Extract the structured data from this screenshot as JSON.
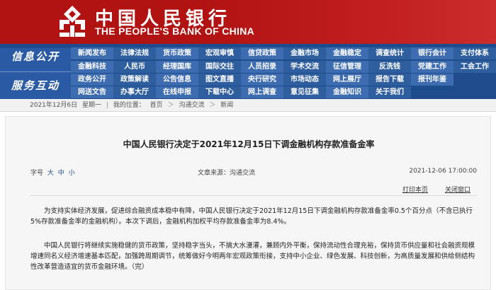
{
  "header": {
    "bank_name_cn": "中国人民银行",
    "bank_name_en": "THE PEOPLE'S BANK OF CHINA",
    "logo_icon": "pboc-emblem-icon",
    "colors": {
      "header_bg": "#b11212",
      "nav_bg": "#1e4b8c"
    }
  },
  "nav": {
    "info_label": "信息公开",
    "service_label": "服务互动",
    "row1": [
      "新闻发布",
      "法律法规",
      "货币政策",
      "宏观审慎",
      "信贷政策",
      "金融市场",
      "金融稳定",
      "调查统计",
      "银行会计",
      "支付体系"
    ],
    "row2": [
      "金融科技",
      "人民币",
      "经理国库",
      "国际交往",
      "人员招录",
      "学术交流",
      "征信管理",
      "反洗钱",
      "党建工作",
      "工会工作"
    ],
    "row3": [
      "政务公开",
      "政策解读",
      "公告信息",
      "图文直播",
      "央行研究",
      "市场动态",
      "网上展厅",
      "报告下载",
      "报刊年鉴"
    ],
    "row4": [
      "网送文告",
      "办事大厅",
      "在线申报",
      "下载中心",
      "网上调查",
      "意见征集",
      "金融知识",
      "关于我们"
    ]
  },
  "breadcrumb": {
    "date": "2021年12月6日",
    "weekday": "星期一",
    "location_prefix": "我的位置：",
    "home": "首页",
    "section": "沟通交流",
    "current": "新闻",
    "separator": "＞"
  },
  "article": {
    "title": "中国人民银行决定于2021年12月15日下调金融机构存款准备金率",
    "font_size_label": "字号",
    "font_sizes": [
      "大",
      "中",
      "小"
    ],
    "source_label": "文章来源：",
    "source": "沟通交流",
    "date": "2021-12-06  17:00:00",
    "print_label": "打印本页",
    "close_label": "关闭窗口",
    "paragraph_1": "为支持实体经济发展，促进综合融资成本稳中有降，中国人民银行决定于2021年12月15日下调金融机构存款准备金率0.5个百分点（不含已执行5%存款准备金率的金融机构）。本次下调后，金融机构加权平均存款准备金率为8.4%。",
    "paragraph_2": "中国人民银行将继续实施稳健的货币政策，坚持稳字当头，不搞大水漫灌，兼顾内外平衡，保持流动性合理充裕，保持货币供应量和社会融资规模增速同名义经济增速基本匹配，加强跨周期调节，统筹做好今明两年宏观政策衔接，支持中小企业、绿色发展、科技创新，为高质量发展和供给侧结构性改革营造适宜的货币金融环境。（完）"
  }
}
